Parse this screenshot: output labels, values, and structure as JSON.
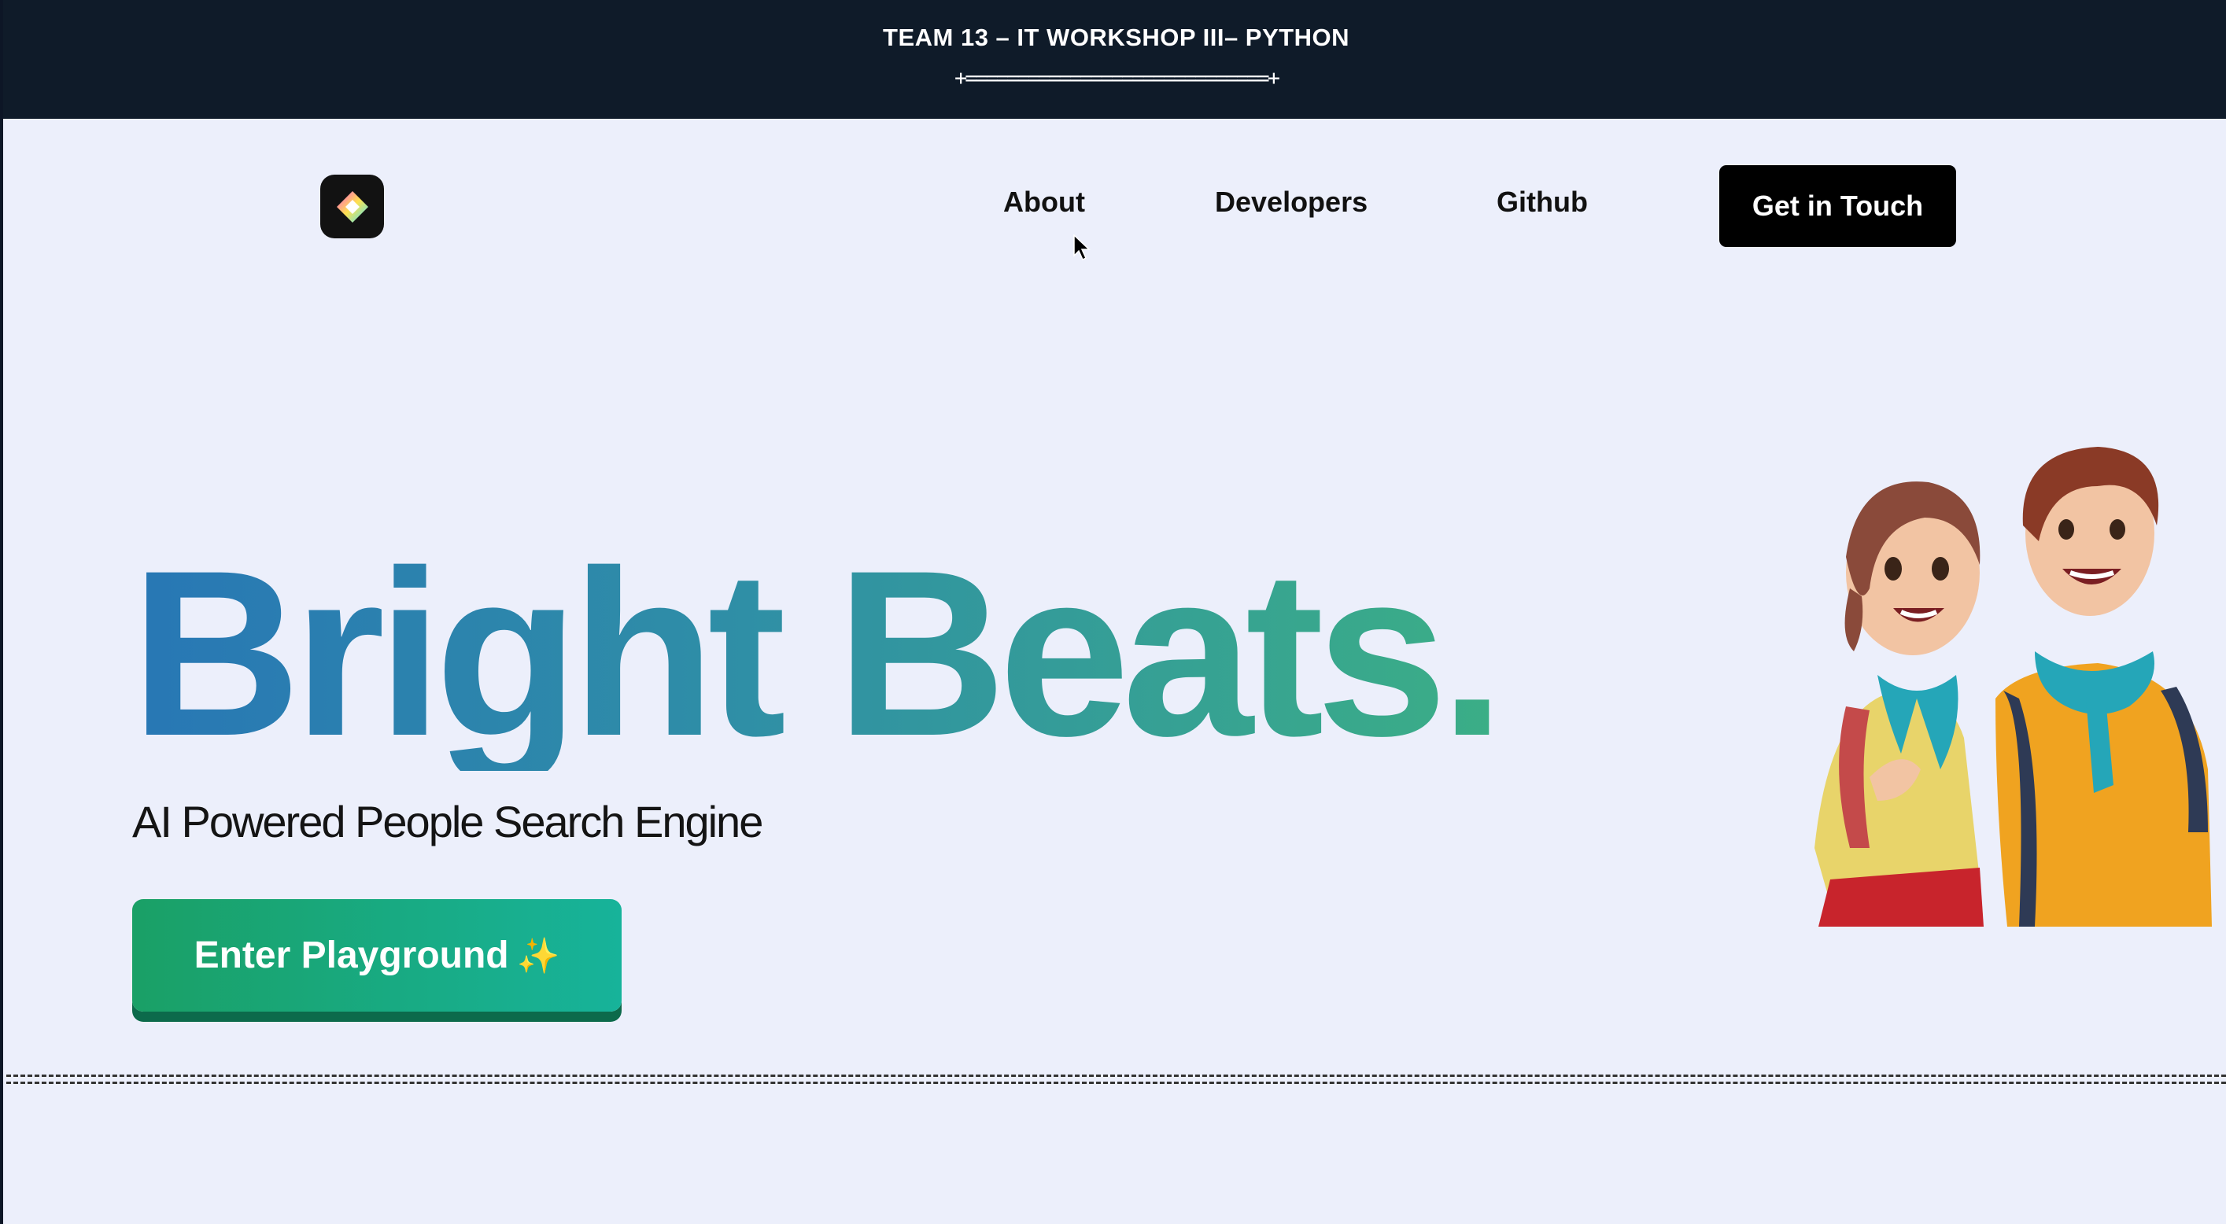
{
  "banner": {
    "title": "TEAM 13 – IT WORKSHOP III– PYTHON",
    "rule": "+=============================+"
  },
  "nav": {
    "logo_icon": "diamond-logo-icon",
    "links": [
      "About",
      "Developers",
      "Github"
    ],
    "cta_label": "Get in Touch"
  },
  "hero": {
    "title": "Bright Beats.",
    "subtitle": "AI Powered People Search Engine",
    "button_label": "Enter Playground",
    "button_icon": "sparkles-icon",
    "illustration": "two-cartoon-students-illustration"
  },
  "colors": {
    "banner_bg": "#0f1b29",
    "gradient_start": "#2877b5",
    "gradient_end": "#3bae86",
    "button_green": "#1aa066"
  }
}
